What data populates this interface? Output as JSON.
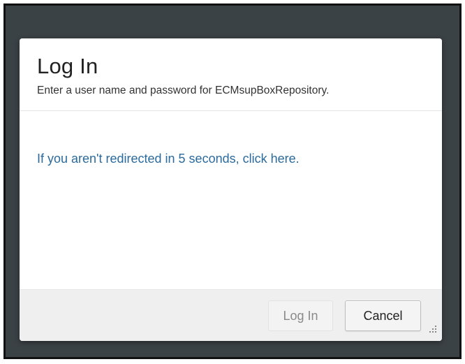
{
  "dialog": {
    "title": "Log In",
    "subtitle": "Enter a user name and password for ECMsupBoxRepository.",
    "redirect_text": "If you aren't redirected in 5 seconds, click here."
  },
  "footer": {
    "login_label": "Log In",
    "cancel_label": "Cancel"
  },
  "colors": {
    "backdrop": "#3b4246",
    "link": "#2a6a9c",
    "footer_bg": "#efefef"
  }
}
